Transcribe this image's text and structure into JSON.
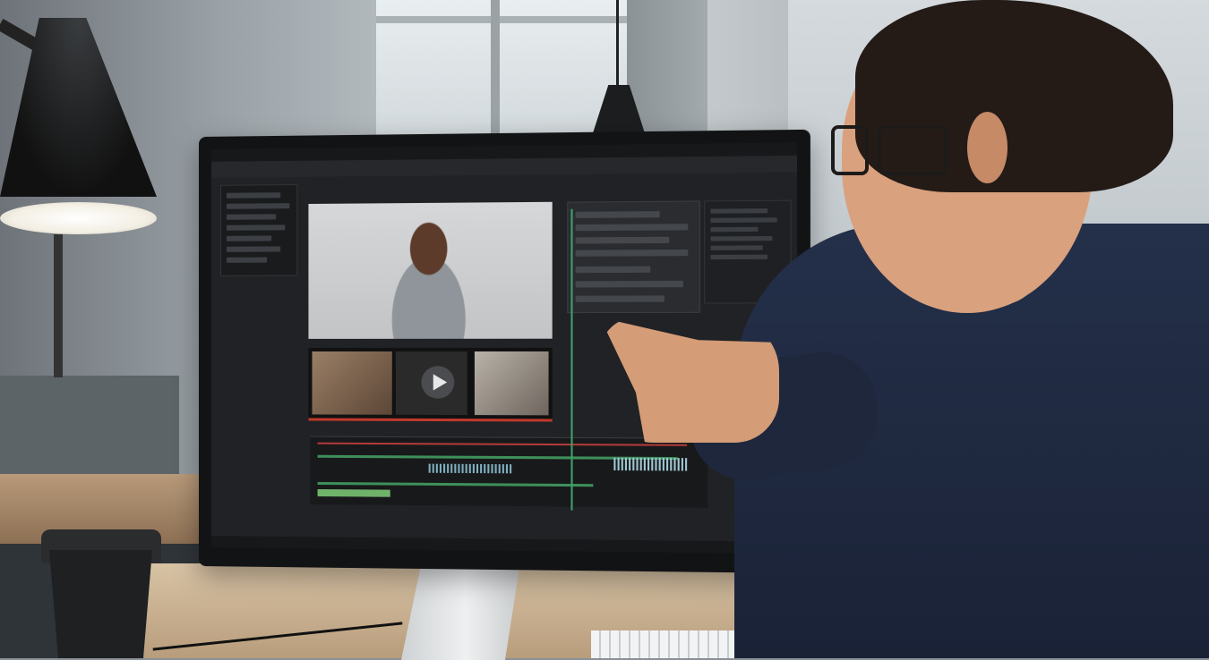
{
  "scene": {
    "description_visible_text": "",
    "palette": {
      "wall": "#b9c0c4",
      "desk": "#d8c3a5",
      "monitor_bezel": "#121315",
      "ui_background": "#202225",
      "sweater": "#24304a",
      "skin": "#d9a17d",
      "accent_green": "#3fa06a",
      "accent_red": "#c0392b"
    },
    "icons": [
      "play-icon"
    ]
  }
}
